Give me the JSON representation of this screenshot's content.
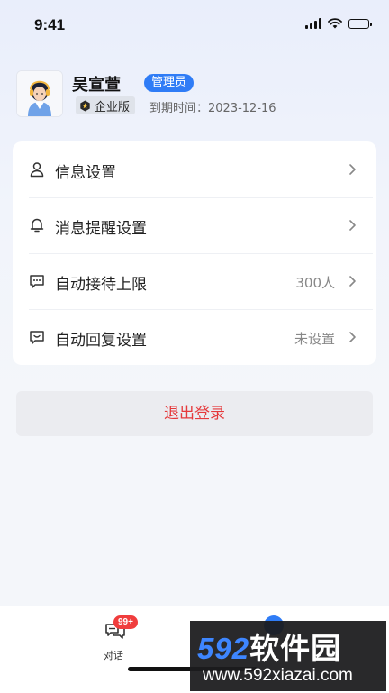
{
  "status_bar": {
    "time": "9:41"
  },
  "profile": {
    "name": "吴宣萱",
    "role_badge": "管理员",
    "edition": "企业版",
    "expiry": "到期时间：2023-12-16"
  },
  "settings": {
    "items": [
      {
        "label": "信息设置",
        "value": "",
        "icon": "user-icon"
      },
      {
        "label": "消息提醒设置",
        "value": "",
        "icon": "bell-icon"
      },
      {
        "label": "自动接待上限",
        "value": "300人",
        "icon": "chat-dots-icon"
      },
      {
        "label": "自动回复设置",
        "value": "未设置",
        "icon": "chat-reply-icon"
      }
    ]
  },
  "logout_label": "退出登录",
  "tab_bar": {
    "chat_label": "对话",
    "chat_badge": "99+"
  },
  "watermark": {
    "title_num": "592",
    "title_cn": "软件园",
    "url": "www.592xiazai.com"
  },
  "colors": {
    "accent": "#2f7cf6",
    "danger": "#e5393b",
    "badge": "#f03d3d"
  }
}
